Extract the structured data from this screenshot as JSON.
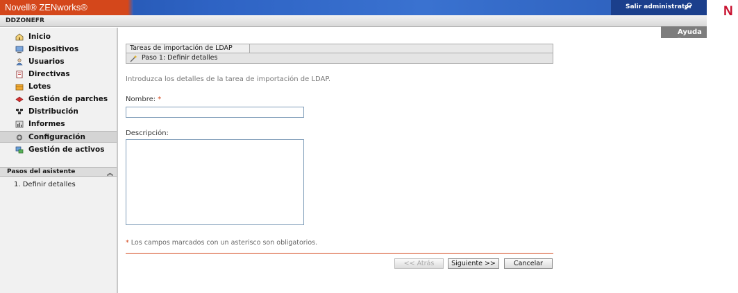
{
  "header": {
    "brand": "Novell® ZENworks®",
    "logout": "Salir administrator",
    "logo_letter": "N",
    "zone": "DDZONEFR",
    "help": "Ayuda ▾"
  },
  "sidebar": {
    "items": [
      {
        "label": "Inicio",
        "icon": "home-icon"
      },
      {
        "label": "Dispositivos",
        "icon": "device-icon"
      },
      {
        "label": "Usuarios",
        "icon": "users-icon"
      },
      {
        "label": "Directivas",
        "icon": "policy-icon"
      },
      {
        "label": "Lotes",
        "icon": "bundles-icon"
      },
      {
        "label": "Gestión de parches",
        "icon": "patch-icon"
      },
      {
        "label": "Distribución",
        "icon": "distribution-icon"
      },
      {
        "label": "Informes",
        "icon": "reports-icon"
      },
      {
        "label": "Configuración",
        "icon": "configuration-icon",
        "active": true
      },
      {
        "label": "Gestión de activos",
        "icon": "asset-icon"
      }
    ],
    "wizard_header": "Pasos del asistente",
    "wizard_steps": [
      "1. Definir detalles"
    ]
  },
  "main": {
    "panel_title": "Tareas de importación de LDAP",
    "step_title": "Paso 1: Definir detalles",
    "intro": "Introduzca los detalles de la tarea de importación de LDAP.",
    "name_label": "Nombre:",
    "required_mark": "*",
    "name_value": "",
    "description_label": "Descripción:",
    "description_value": "",
    "required_note": "Los campos marcados con un asterisco son obligatorios."
  },
  "buttons": {
    "back": "<< Atrás",
    "next": "Siguiente >>",
    "cancel": "Cancelar"
  },
  "colors": {
    "brand_orange": "#d4471b",
    "banner_blue": "#2e63c4",
    "novell_red": "#c8102e"
  }
}
